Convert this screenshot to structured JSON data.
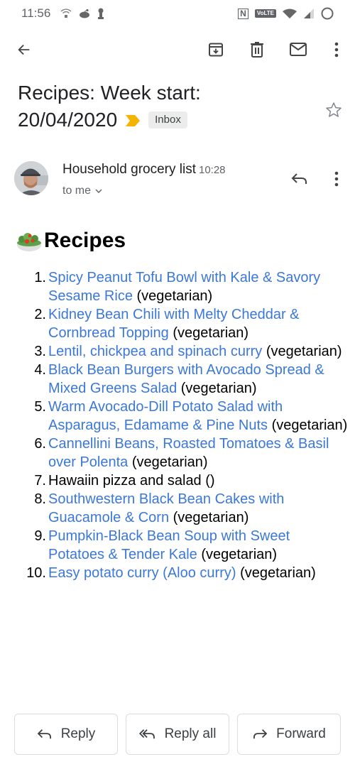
{
  "status_bar": {
    "time": "11:56",
    "left_icons": [
      "wifi-calling-icon",
      "reddit-icon",
      "keyhole-icon"
    ],
    "right_icons": [
      "nfc-icon",
      "volte-icon",
      "wifi-icon",
      "signal-icon",
      "battery-icon"
    ],
    "nfc_label": "N",
    "volte_label": "VoLTE"
  },
  "toolbar": {
    "back_icon": "arrow-left-icon",
    "actions": [
      "archive-icon",
      "delete-icon",
      "mark-unread-icon",
      "more-vert-icon"
    ]
  },
  "email": {
    "subject_line1": "Recipes: Week start:",
    "subject_line2": "20/04/2020",
    "label": "Inbox",
    "importance_color": "#f4b400",
    "starred": false,
    "sender": "Household grocery list",
    "time": "10:28",
    "recipient": "to me"
  },
  "body": {
    "heading_icon": "green-salad-emoji",
    "heading": "Recipes",
    "link_color": "#3b78d8",
    "recipes": [
      {
        "num": "1.",
        "title": "Spicy Peanut Tofu Bowl with Kale & Savory Sesame Rice",
        "note": "(vegetarian)",
        "linked": true
      },
      {
        "num": "2.",
        "title": "Kidney Bean Chili with Melty Cheddar & Cornbread Topping",
        "note": "(vegetarian)",
        "linked": true
      },
      {
        "num": "3.",
        "title": "Lentil, chickpea and spinach curry",
        "note": "(vegetarian)",
        "linked": true
      },
      {
        "num": "4.",
        "title": "Black Bean Burgers with Avocado Spread & Mixed Greens Salad",
        "note": "(vegetarian)",
        "linked": true
      },
      {
        "num": "5.",
        "title": "Warm Avocado-Dill Potato Salad with Asparagus, Edamame & Pine Nuts",
        "note": "(vegetarian)",
        "linked": true
      },
      {
        "num": "6.",
        "title": "Cannellini Beans, Roasted Tomatoes & Basil over Polenta",
        "note": "(vegetarian)",
        "linked": true
      },
      {
        "num": "7.",
        "title": "Hawaiin pizza and salad",
        "note": "()",
        "linked": false
      },
      {
        "num": "8.",
        "title": "Southwestern Black Bean Cakes with Guacamole & Corn",
        "note": "(vegetarian)",
        "linked": true
      },
      {
        "num": "9.",
        "title": "Pumpkin-Black Bean Soup with Sweet Potatoes & Tender Kale",
        "note": "(vegetarian)",
        "linked": true
      },
      {
        "num": "10.",
        "title": "Easy potato curry (Aloo curry)",
        "note": "(vegetarian)",
        "linked": true
      }
    ]
  },
  "actions": {
    "reply": "Reply",
    "reply_all": "Reply all",
    "forward": "Forward"
  }
}
